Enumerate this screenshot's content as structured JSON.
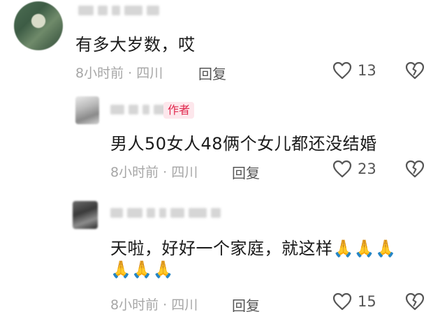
{
  "comments": [
    {
      "text": "有多大岁数，哎",
      "meta": "8小时前 · 四川",
      "reply_label": "回复",
      "likes": "13"
    },
    {
      "author_tag": "作者",
      "text": "男人50女人48俩个女儿都还没结婚",
      "meta": "8小时前 · 四川",
      "reply_label": "回复",
      "likes": "23"
    },
    {
      "text_line1": "天啦，好好一个家庭，就这样🙏🙏🙏",
      "text_line2": "🙏🙏🙏",
      "meta": "8小时前 · 四川",
      "reply_label": "回复",
      "likes": "15"
    }
  ],
  "icons": {
    "like": "heart-outline-icon",
    "dislike": "broken-heart-icon"
  }
}
